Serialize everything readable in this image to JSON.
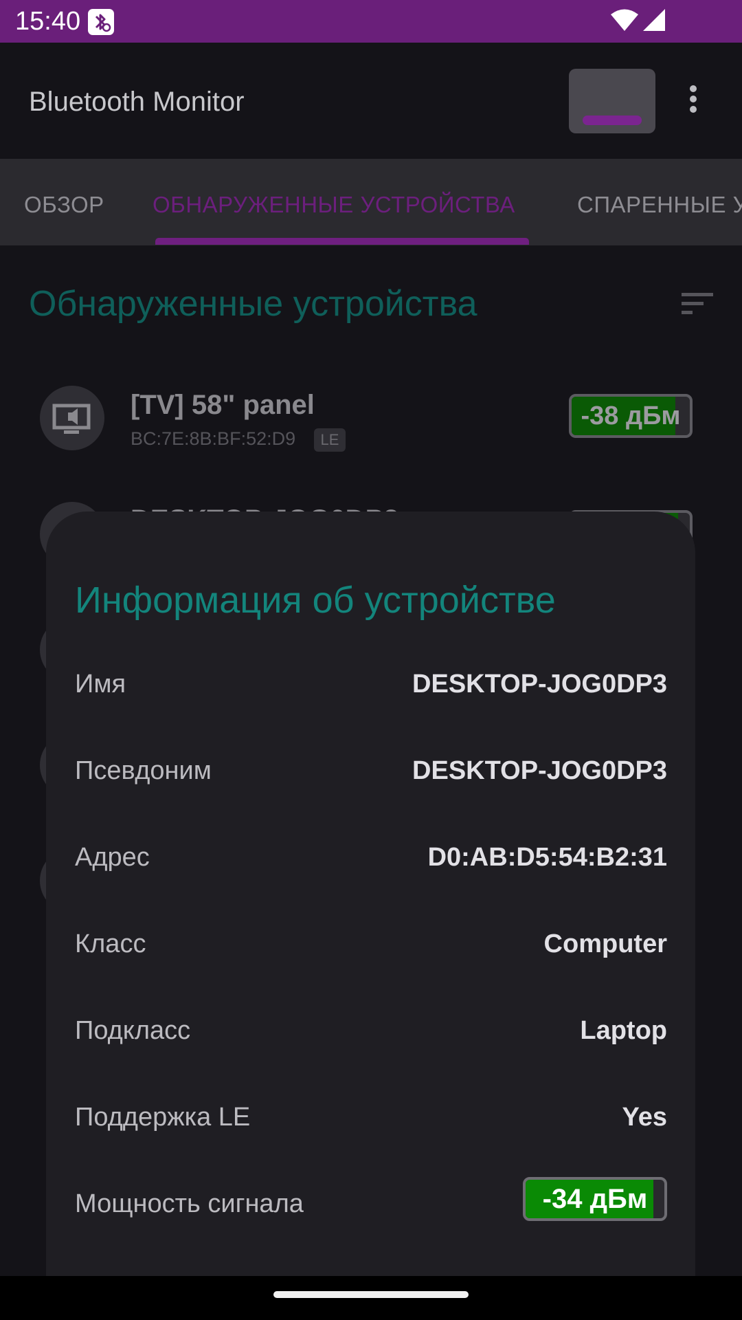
{
  "status_bar": {
    "time": "15:40",
    "icons": [
      "bluetooth-scan-icon",
      "wifi-icon",
      "cellular-icon"
    ]
  },
  "app_bar": {
    "title": "Bluetooth Monitor",
    "icons": [
      "scan-toggle",
      "more-vert-icon"
    ]
  },
  "tabs": [
    {
      "label": "ОБЗОР",
      "active": false
    },
    {
      "label": "ОБНАРУЖЕННЫЕ УСТРОЙСТВА",
      "active": true
    },
    {
      "label": "СПАРЕННЫЕ УСТРОЙСТВА",
      "active": false
    }
  ],
  "section": {
    "title": "Обнаруженные устройства",
    "sort_icon": "sort-icon"
  },
  "devices": [
    {
      "name": "[TV] 58\" panel",
      "mac": "BC:7E:8B:BF:52:D9",
      "badge": "LE",
      "rssi": "-38 дБм",
      "signal_fraction": 0.88,
      "icon": "tv-speaker-icon"
    },
    {
      "name": "DESKTOP-JOG0DP3",
      "mac": "",
      "badge": "",
      "rssi": "",
      "signal_fraction": 0.9,
      "icon": "computer-icon"
    }
  ],
  "dialog": {
    "title": "Информация об устройстве",
    "rows": [
      {
        "label": "Имя",
        "value": "DESKTOP-JOG0DP3"
      },
      {
        "label": "Псевдоним",
        "value": "DESKTOP-JOG0DP3"
      },
      {
        "label": "Адрес",
        "value": "D0:AB:D5:54:B2:31"
      },
      {
        "label": "Класс",
        "value": "Computer"
      },
      {
        "label": "Подкласс",
        "value": "Laptop"
      },
      {
        "label": "Поддержка LE",
        "value": "Yes"
      }
    ],
    "signal": {
      "label": "Мощность сигнала",
      "value": "-34 дБм",
      "fill_fraction": 0.92
    }
  },
  "colors": {
    "status_bar": "#6a1f7a",
    "accent_purple": "#6f1f80",
    "accent_teal": "#13857c",
    "signal_green": "#0a8a05"
  }
}
